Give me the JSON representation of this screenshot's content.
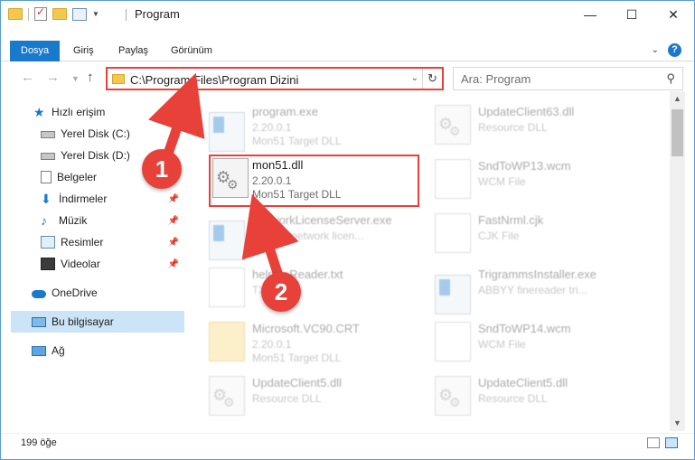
{
  "titlebar": {
    "title": "Program",
    "minimize": "—",
    "maximize": "☐",
    "close": "✕"
  },
  "ribbon": {
    "tabs": [
      {
        "label": "Dosya",
        "active": true
      },
      {
        "label": "Giriş"
      },
      {
        "label": "Paylaş"
      },
      {
        "label": "Görünüm"
      }
    ],
    "help": "?"
  },
  "nav": {
    "address_path": "C:\\Program Files\\Program Dizini",
    "search_placeholder": "Ara: Program"
  },
  "sidebar": {
    "items": [
      {
        "label": "Hızlı erişim",
        "icon": "star-icon"
      },
      {
        "label": "Yerel Disk (C:)",
        "icon": "drive-icon"
      },
      {
        "label": "Yerel Disk (D:)",
        "icon": "drive-icon"
      },
      {
        "label": "Belgeler",
        "icon": "documents-icon"
      },
      {
        "label": "İndirmeler",
        "icon": "download-icon",
        "pinned": true
      },
      {
        "label": "Müzik",
        "icon": "music-icon",
        "pinned": true
      },
      {
        "label": "Resimler",
        "icon": "pictures-icon",
        "pinned": true
      },
      {
        "label": "Videolar",
        "icon": "video-icon",
        "pinned": true
      },
      {
        "label": "OneDrive",
        "icon": "onedrive-icon"
      },
      {
        "label": "Bu bilgisayar",
        "icon": "computer-icon",
        "selected": true
      },
      {
        "label": "Ağ",
        "icon": "network-icon"
      }
    ]
  },
  "files": {
    "program_exe": {
      "name": "program.exe",
      "line2": "2.20.0.1",
      "line3": "Mon51 Target DLL"
    },
    "mon51_dll": {
      "name": "mon51.dll",
      "line2": "2.20.0.1",
      "line3": "Mon51 Target DLL"
    },
    "network_license": {
      "name": "NetworkLicenseServer.exe",
      "line2": "ABBYY network licen..."
    },
    "helpfile_reader": {
      "name": "helpfileReader.txt",
      "line2": "TXT"
    },
    "msvc90": {
      "name": "Microsoft.VC90.CRT",
      "line2": "2.20.0.1",
      "line3": "Mon51 Target DLL"
    },
    "updateclient5_left": {
      "name": "UpdateClient5.dll",
      "line2": "Resource DLL"
    },
    "updateclient63": {
      "name": "UpdateClient63.dll",
      "line2": "Resource DLL"
    },
    "sndtowp13": {
      "name": "SndToWP13.wcm",
      "line2": "WCM File"
    },
    "fastnrml": {
      "name": "FastNrml.cjk",
      "line2": "CJK File"
    },
    "trigramms": {
      "name": "TrigrammsInstaller.exe",
      "line2": "ABBYY finereader tri..."
    },
    "sndtowp14": {
      "name": "SndToWP14.wcm",
      "line2": "WCM File"
    },
    "updateclient5_right": {
      "name": "UpdateClient5.dll",
      "line2": "Resource DLL"
    }
  },
  "status": {
    "count": "199 öğe"
  },
  "annotations": {
    "step1": "1",
    "step2": "2",
    "accent": "#e8413a"
  }
}
